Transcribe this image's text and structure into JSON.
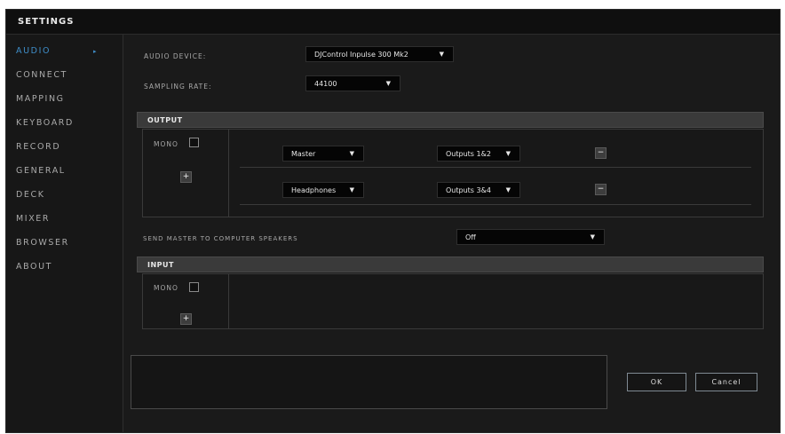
{
  "window": {
    "title": "SETTINGS"
  },
  "sidebar": {
    "items": [
      {
        "label": "AUDIO"
      },
      {
        "label": "CONNECT"
      },
      {
        "label": "MAPPING"
      },
      {
        "label": "KEYBOARD"
      },
      {
        "label": "RECORD"
      },
      {
        "label": "GENERAL"
      },
      {
        "label": "DECK"
      },
      {
        "label": "MIXER"
      },
      {
        "label": "BROWSER"
      },
      {
        "label": "ABOUT"
      }
    ],
    "active_index": 0
  },
  "audio_device": {
    "label": "AUDIO DEVICE:",
    "value": "DJControl Inpulse 300 Mk2"
  },
  "sampling_rate": {
    "label": "SAMPLING RATE:",
    "value": "44100"
  },
  "output": {
    "header": "OUTPUT",
    "mono_label": "MONO",
    "mono_checked": false,
    "add_label": "+",
    "rows": [
      {
        "channel": "Master",
        "output": "Outputs 1&2",
        "remove_label": "−"
      },
      {
        "channel": "Headphones",
        "output": "Outputs 3&4",
        "remove_label": "−"
      }
    ]
  },
  "send_master": {
    "label": "SEND MASTER TO COMPUTER SPEAKERS",
    "value": "Off"
  },
  "input": {
    "header": "INPUT",
    "mono_label": "MONO",
    "mono_checked": false,
    "add_label": "+"
  },
  "footer": {
    "ok_label": "OK",
    "cancel_label": "Cancel"
  },
  "colors": {
    "accent": "#3f8ec9",
    "background": "#1a1a1a",
    "section_header": "#3a3a3a"
  }
}
